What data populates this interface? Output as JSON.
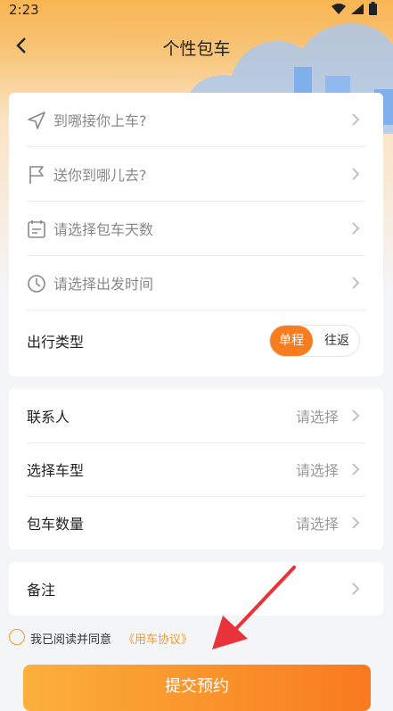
{
  "status": {
    "time": "2:23"
  },
  "header": {
    "title": "个性包车"
  },
  "trip": {
    "pickup_placeholder": "到哪接你上车?",
    "dest_placeholder": "送你到哪儿去?",
    "days_placeholder": "请选择包车天数",
    "time_placeholder": "请选择出发时间",
    "type_label": "出行类型",
    "type_options": [
      "单程",
      "往返"
    ],
    "type_selected": "单程"
  },
  "contact": {
    "contact_label": "联系人",
    "contact_value": "请选择",
    "car_label": "选择车型",
    "car_value": "请选择",
    "count_label": "包车数量",
    "count_value": "请选择"
  },
  "remark": {
    "label": "备注"
  },
  "agreement": {
    "text": "我已阅读并同意",
    "link": "《用车协议》"
  },
  "submit_label": "提交预约",
  "colors": {
    "accent": "#f97d1f",
    "link": "#f59a2e"
  }
}
